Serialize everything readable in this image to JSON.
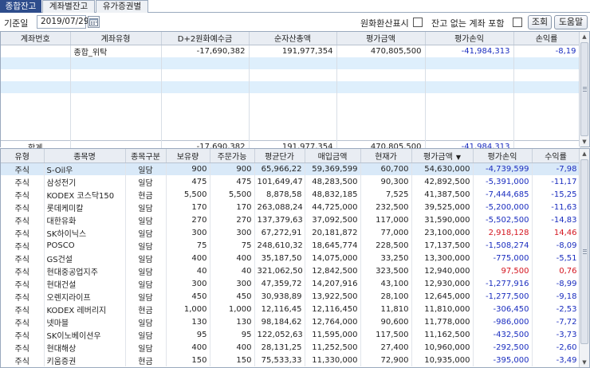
{
  "tabs": [
    "종합잔고",
    "계좌별잔고",
    "유가증권별"
  ],
  "toolbar": {
    "date_label": "기준일",
    "date_value": "2019/07/29",
    "fx_label": "원화환산표시",
    "include_label": "잔고 없는 계좌 포함",
    "search_button": "조회",
    "help_button": "도움말"
  },
  "summary": {
    "headers": [
      "계좌번호",
      "계좌유형",
      "D+2원화예수금",
      "순자산총액",
      "평가금액",
      "평가손익",
      "손익률"
    ],
    "row": {
      "account": "",
      "type": "종합_위탁",
      "deposit": "-17,690,382",
      "net_assets": "191,977,354",
      "eval": "470,805,500",
      "pnl": "-41,984,313",
      "rate": "-8,19"
    },
    "total": {
      "label": "합계",
      "deposit": "-17,690,382",
      "net_assets": "191,977,354",
      "eval": "470,805,500",
      "pnl": "-41,984,313"
    }
  },
  "holdings": {
    "headers": [
      "유형",
      "종목명",
      "종목구분",
      "보유량",
      "주문가능",
      "평균단가",
      "매입금액",
      "현재가",
      "평가금액",
      "평가손익",
      "수익률"
    ],
    "sort_icon": "▼",
    "rows": [
      [
        "주식",
        "S-Oil우",
        "일담",
        "900",
        "900",
        "65,966,22",
        "59,369,599",
        "60,700",
        "54,630,000",
        "-4,739,599",
        "-7,98"
      ],
      [
        "주식",
        "삼성전기",
        "일담",
        "475",
        "475",
        "101,649,47",
        "48,283,500",
        "90,300",
        "42,892,500",
        "-5,391,000",
        "-11,17"
      ],
      [
        "주식",
        "KODEX 코스닥150",
        "현금",
        "5,500",
        "5,500",
        "8,878,58",
        "48,832,185",
        "7,525",
        "41,387,500",
        "-7,444,685",
        "-15,25"
      ],
      [
        "주식",
        "롯데케미칼",
        "일담",
        "170",
        "170",
        "263,088,24",
        "44,725,000",
        "232,500",
        "39,525,000",
        "-5,200,000",
        "-11,63"
      ],
      [
        "주식",
        "대한유화",
        "일담",
        "270",
        "270",
        "137,379,63",
        "37,092,500",
        "117,000",
        "31,590,000",
        "-5,502,500",
        "-14,83"
      ],
      [
        "주식",
        "SK하이닉스",
        "일담",
        "300",
        "300",
        "67,272,91",
        "20,181,872",
        "77,000",
        "23,100,000",
        "2,918,128",
        "14,46"
      ],
      [
        "주식",
        "POSCO",
        "일담",
        "75",
        "75",
        "248,610,32",
        "18,645,774",
        "228,500",
        "17,137,500",
        "-1,508,274",
        "-8,09"
      ],
      [
        "주식",
        "GS건설",
        "일담",
        "400",
        "400",
        "35,187,50",
        "14,075,000",
        "33,250",
        "13,300,000",
        "-775,000",
        "-5,51"
      ],
      [
        "주식",
        "현대중공업지주",
        "일담",
        "40",
        "40",
        "321,062,50",
        "12,842,500",
        "323,500",
        "12,940,000",
        "97,500",
        "0,76"
      ],
      [
        "주식",
        "현대건설",
        "일담",
        "300",
        "300",
        "47,359,72",
        "14,207,916",
        "43,100",
        "12,930,000",
        "-1,277,916",
        "-8,99"
      ],
      [
        "주식",
        "오렌지라이프",
        "일담",
        "450",
        "450",
        "30,938,89",
        "13,922,500",
        "28,100",
        "12,645,000",
        "-1,277,500",
        "-9,18"
      ],
      [
        "주식",
        "KODEX 레버리지",
        "현금",
        "1,000",
        "1,000",
        "12,116,45",
        "12,116,450",
        "11,810",
        "11,810,000",
        "-306,450",
        "-2,53"
      ],
      [
        "주식",
        "넷마블",
        "일담",
        "130",
        "130",
        "98,184,62",
        "12,764,000",
        "90,600",
        "11,778,000",
        "-986,000",
        "-7,72"
      ],
      [
        "주식",
        "SK이노베이션우",
        "일담",
        "95",
        "95",
        "122,052,63",
        "11,595,000",
        "117,500",
        "11,162,500",
        "-432,500",
        "-3,73"
      ],
      [
        "주식",
        "현대해상",
        "일담",
        "400",
        "400",
        "28,131,25",
        "11,252,500",
        "27,400",
        "10,960,000",
        "-292,500",
        "-2,60"
      ],
      [
        "주식",
        "키움증권",
        "현금",
        "150",
        "150",
        "75,533,33",
        "11,330,000",
        "72,900",
        "10,935,000",
        "-395,000",
        "-3,49"
      ]
    ]
  },
  "colors": {
    "loss": "#1a2dbf",
    "gain": "#d4151f",
    "tab_active": "#2e4d8c",
    "selected_row": "#d9e9f8"
  },
  "icons": {
    "calendar": "calendar-icon",
    "sort": "sort-desc-icon"
  }
}
